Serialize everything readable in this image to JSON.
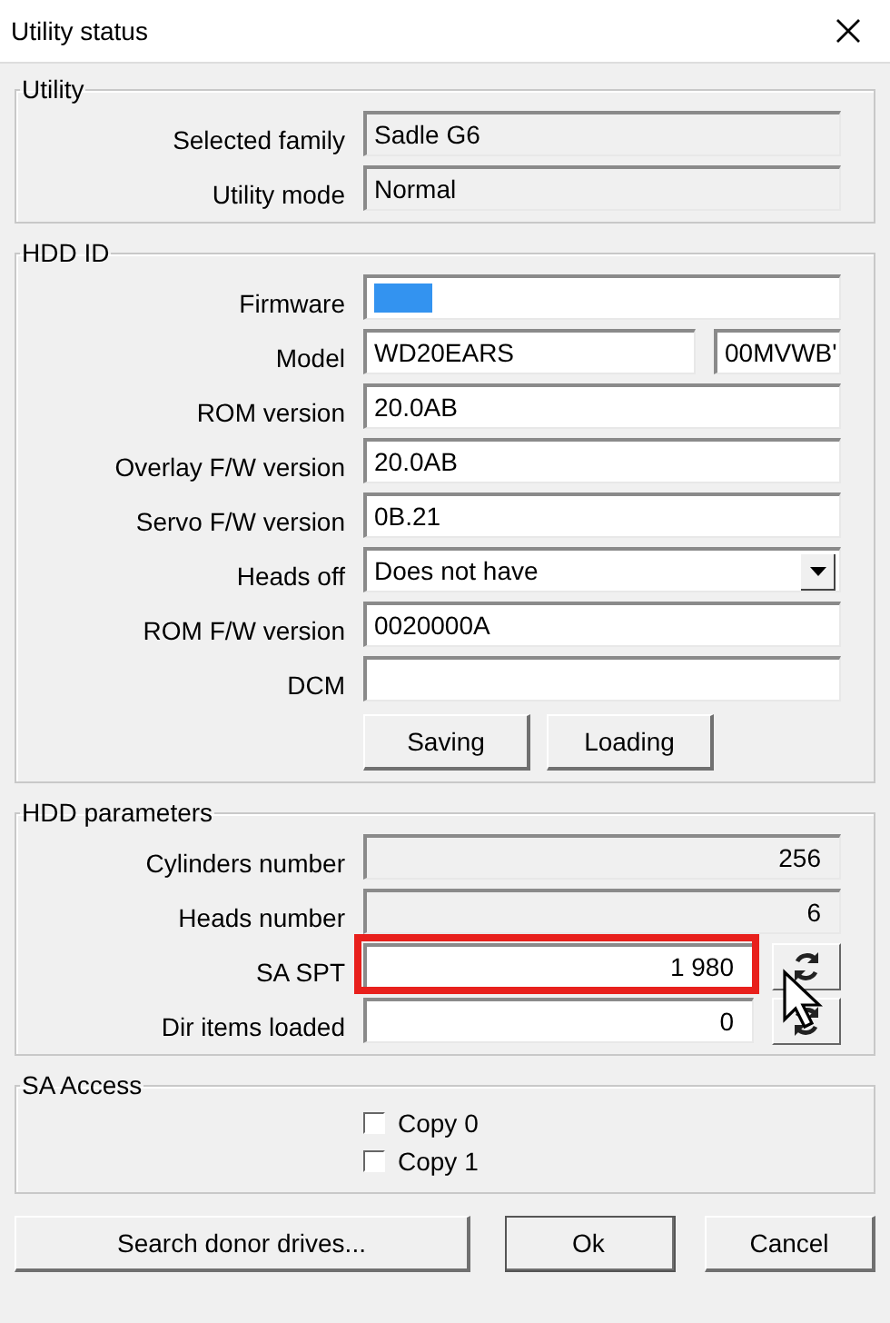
{
  "window": {
    "title": "Utility status"
  },
  "groups": [
    {
      "title": "Utility",
      "rows": [
        {
          "label": "Selected family",
          "fields": [
            {
              "kind": "readonly",
              "value": "Sadle G6"
            }
          ]
        },
        {
          "label": "Utility mode",
          "fields": [
            {
              "kind": "readonly",
              "value": "Normal"
            }
          ]
        }
      ]
    },
    {
      "title": "HDD ID",
      "rows": [
        {
          "label": "Firmware",
          "fields": [
            {
              "kind": "selection"
            }
          ]
        },
        {
          "label": "Model",
          "fields": [
            {
              "kind": "text",
              "value": "WD20EARS"
            },
            {
              "kind": "text",
              "value": "00MVWB'"
            }
          ]
        },
        {
          "label": "ROM version",
          "fields": [
            {
              "kind": "text",
              "value": "20.0AB"
            }
          ]
        },
        {
          "label": "Overlay F/W version",
          "fields": [
            {
              "kind": "text",
              "value": "20.0AB"
            }
          ]
        },
        {
          "label": "Servo F/W version",
          "fields": [
            {
              "kind": "text",
              "value": "0B.21"
            }
          ]
        },
        {
          "label": "Heads off",
          "fields": [
            {
              "kind": "select",
              "value": "Does not have"
            }
          ]
        },
        {
          "label": "ROM F/W version",
          "fields": [
            {
              "kind": "text",
              "value": "0020000A"
            }
          ]
        },
        {
          "label": "DCM",
          "fields": [
            {
              "kind": "text"
            }
          ]
        }
      ],
      "buttons": [
        "Saving",
        "Loading"
      ]
    },
    {
      "title": "HDD parameters",
      "rows": [
        {
          "label": "Cylinders number",
          "refresh": false,
          "highlighted": false,
          "fields": [
            {
              "kind": "readonly",
              "right_aligned": true,
              "value": "256"
            }
          ]
        },
        {
          "label": "Heads number",
          "refresh": false,
          "highlighted": false,
          "fields": [
            {
              "kind": "readonly",
              "right_aligned": true,
              "value": "6"
            }
          ]
        },
        {
          "label": "SA SPT",
          "refresh": true,
          "highlighted": true,
          "fields": [
            {
              "kind": "text",
              "right_aligned": true,
              "value": "1 980"
            }
          ]
        },
        {
          "label": "Dir items loaded",
          "refresh": true,
          "highlighted": false,
          "fields": [
            {
              "kind": "text",
              "right_aligned": true,
              "value": "0"
            }
          ]
        }
      ]
    },
    {
      "title": "SA Access",
      "checkboxes": [
        {
          "label": "Copy 0",
          "checked": false
        },
        {
          "label": "Copy 1",
          "checked": false
        }
      ]
    }
  ],
  "buttons": [
    {
      "label": "Search donor drives...",
      "default": false
    },
    {
      "label": "Ok",
      "default": true
    },
    {
      "label": "Cancel",
      "default": false
    }
  ]
}
